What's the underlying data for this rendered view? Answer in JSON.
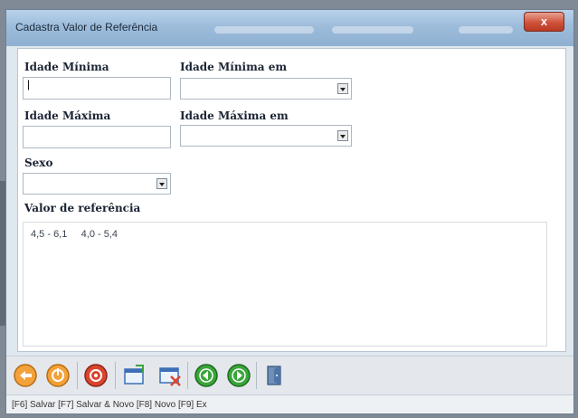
{
  "window": {
    "title": "Cadastra Valor de Referência",
    "close_label": "x"
  },
  "form": {
    "idade_minima_label": "Idade Mínima",
    "idade_minima_value": "|",
    "idade_minima_em_label": "Idade Mínima em",
    "idade_minima_em_value": "",
    "idade_maxima_label": "Idade Máxima",
    "idade_maxima_value": "",
    "idade_maxima_em_label": "Idade Máxima em",
    "idade_maxima_em_value": "",
    "sexo_label": "Sexo",
    "sexo_value": "",
    "valor_label": "Valor de referência",
    "valor_value": "4,5 - 6,1     4,0 - 5,4"
  },
  "toolbar": {
    "icons": [
      "save-icon",
      "save-new-icon",
      "cancel-icon",
      "new-icon",
      "close-window-icon",
      "previous-icon",
      "next-icon",
      "exit-icon"
    ]
  },
  "statusbar": {
    "text": "[F6] Salvar [F7] Salvar & Novo [F8] Novo [F9] Ex"
  },
  "colors": {
    "titlebar": "#9dbcdb",
    "close": "#d0513a",
    "orange": "#f3a13a",
    "red": "#d9452f",
    "green": "#3aa53a",
    "blue": "#3d6fb6"
  }
}
